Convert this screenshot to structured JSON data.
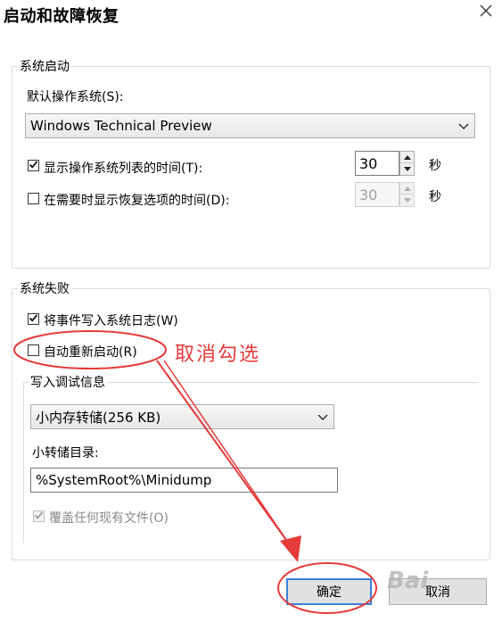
{
  "window": {
    "title": "启动和故障恢复"
  },
  "startup": {
    "group_label": "系统启动",
    "default_os_label": "默认操作系统(S):",
    "default_os_value": "Windows Technical Preview",
    "show_list_label": "显示操作系统列表的时间(T):",
    "show_list_checked": true,
    "show_list_value": "30",
    "show_recovery_label": "在需要时显示恢复选项的时间(D):",
    "show_recovery_checked": false,
    "show_recovery_value": "30",
    "seconds_unit": "秒"
  },
  "failure": {
    "group_label": "系统失败",
    "write_event_label": "将事件写入系统日志(W)",
    "write_event_checked": true,
    "auto_restart_label": "自动重新启动(R)",
    "auto_restart_checked": false,
    "debug_group_label": "写入调试信息",
    "debug_type_value": "小内存转储(256 KB)",
    "dump_dir_label": "小转储目录:",
    "dump_dir_value": "%SystemRoot%\\Minidump",
    "overwrite_label": "覆盖任何现有文件(O)",
    "overwrite_checked": true
  },
  "buttons": {
    "ok": "确定",
    "cancel": "取消"
  },
  "annotation": {
    "text": "取消勾选",
    "color": "#e53b3b"
  },
  "watermark": {
    "text": "Bai"
  },
  "icons": {
    "close": "close-icon",
    "dropdown": "chevron-down-icon",
    "check": "check-icon",
    "spin_up": "triangle-up-icon",
    "spin_down": "triangle-down-icon"
  }
}
